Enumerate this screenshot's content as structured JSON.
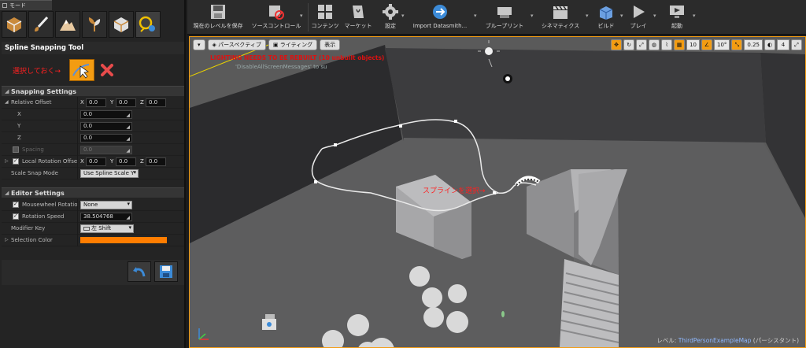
{
  "modes": {
    "tab_label": "モード",
    "icons": [
      "place-mode-icon",
      "paint-mode-icon",
      "landscape-mode-icon",
      "foliage-mode-icon",
      "geometry-mode-icon",
      "spline-snapping-mode-icon"
    ]
  },
  "tool": {
    "title": "Spline Snapping Tool",
    "select_hint": "選択しておく→"
  },
  "snapping": {
    "header": "Snapping Settings",
    "relative_offset": {
      "label": "Relative Offset",
      "x": "0.0",
      "y": "0.0",
      "z": "0.0",
      "x_axis": "X",
      "y_axis": "Y",
      "z_axis": "Z"
    },
    "x_label": "X",
    "x_value": "0.0",
    "y_label": "Y",
    "y_value": "0.0",
    "z_label": "Z",
    "z_value": "0.0",
    "spacing_label": "Spacing",
    "spacing_value": "0.0",
    "local_rotation": {
      "label": "Local Rotation Offset",
      "x": "0.0",
      "y": "0.0",
      "z": "0.0",
      "x_axis": "X",
      "y_axis": "Y",
      "z_axis": "Z"
    },
    "scale_snap_label": "Scale Snap Mode",
    "scale_snap_value": "Use Spline Scale Y"
  },
  "editor": {
    "header": "Editor Settings",
    "mousewheel_label": "Mousewheel Rotation A",
    "mousewheel_value": "None",
    "rotation_speed_label": "Rotation Speed",
    "rotation_speed_value": "38.504768",
    "modifier_key_label": "Modifier Key",
    "modifier_key_value": "左 Shift",
    "selection_color_label": "Selection Color",
    "selection_color": "#ff7d00"
  },
  "toolbar": {
    "save_level": "現在のレベルを保存",
    "source_control": "ソースコントロール",
    "content": "コンテンツ",
    "marketplace": "マーケット",
    "settings": "設定",
    "import_datasmith": "Import Datasmith...",
    "blueprints": "ブループリント",
    "cinematics": "シネマティクス",
    "build": "ビルド",
    "play": "プレイ",
    "launch": "起動"
  },
  "viewport": {
    "perspective": "パースペクティブ",
    "lighting": "ライティング",
    "show": "表示",
    "lighting_warning": "LIGHTING NEEDS TO BE REBUILT (10 unbuilt objects)",
    "disable_msg": "'DisableAllScreenMessages' to su",
    "spline_hint": "スプラインを選択→",
    "grid_snap": "10",
    "rotation_snap": "10°",
    "scale_snap": "0.25",
    "camera_speed": "4",
    "level_prefix": "レベル:",
    "level_name": "ThirdPersonExampleMap",
    "level_suffix": "(パーシスタント)"
  }
}
